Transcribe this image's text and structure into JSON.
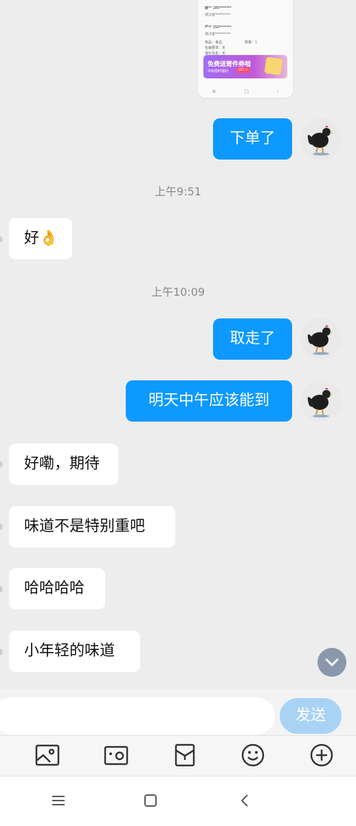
{
  "shared_card": {
    "line1": "鹿**  185*******",
    "line2": "浙江省*********",
    "line3": "严**  150*******",
    "line4": "浙江省*********",
    "line5": "物品：食品",
    "line6": "数量：1",
    "line7": "包装要求：无",
    "line8": "保价信息：无",
    "promo_title": "免费送寄件券啦",
    "promo_sub": "中秋限时福利",
    "promo_tag": "GO >"
  },
  "messages": {
    "m1": "下单了",
    "ts1": "上午9:51",
    "m2": "好👌",
    "ts2": "上午10:09",
    "m3": "取走了",
    "m4": "明天中午应该能到",
    "m5": "好嘞，期待",
    "m6": "味道不是特别重吧",
    "m7": "哈哈哈哈",
    "m8": "小年轻的味道"
  },
  "input": {
    "placeholder": "",
    "send_label": "发送"
  },
  "toolbar": {
    "items": [
      "image-icon",
      "camera-icon",
      "red-packet-icon",
      "emoji-icon",
      "plus-icon"
    ]
  },
  "colors": {
    "my_bubble": "#0d99ff",
    "their_bubble": "#ffffff",
    "background": "#ededed",
    "send_button": "#a9d3f5"
  }
}
